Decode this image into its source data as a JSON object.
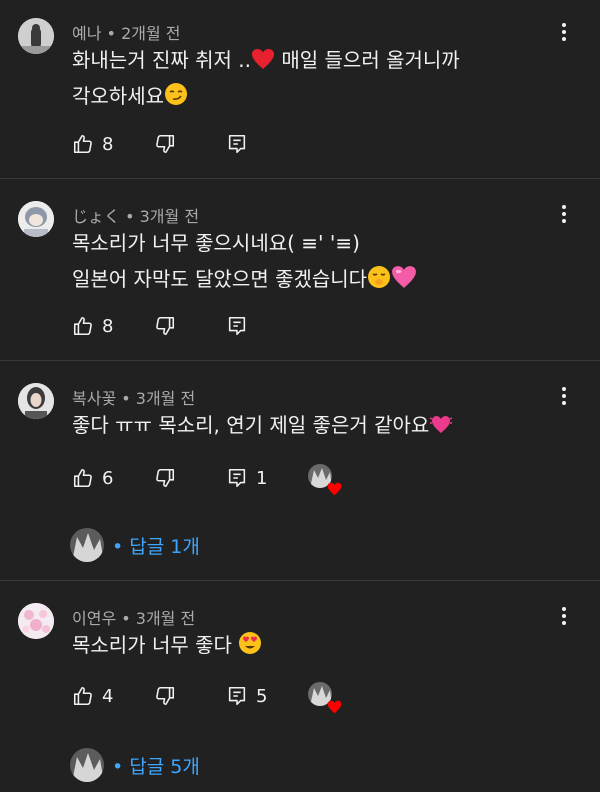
{
  "comments": [
    {
      "author": "예나",
      "time": "2개월 전",
      "lines": [
        "화내는거 진짜 취저 ..",
        " 매일 들으러 올거니까",
        "각오하세요"
      ],
      "likes": "8"
    },
    {
      "author": "じょく",
      "time": "3개월 전",
      "lines": [
        "목소리가 너무 좋으시네요( ≡' '≡)",
        "일본어 자막도 달았으면 좋겠습니다"
      ],
      "likes": "8"
    },
    {
      "author": "복사꽃",
      "time": "3개월 전",
      "lines": [
        "좋다 ㅠㅠ 목소리, 연기 제일 좋은거 같아요"
      ],
      "likes": "6",
      "reply_count": "1",
      "replies_label": "• 답글 1개"
    },
    {
      "author": "이연우",
      "time": "3개월 전",
      "lines": [
        "목소리가 너무 좋다 "
      ],
      "likes": "4",
      "reply_count": "5",
      "replies_label": "• 답글 5개"
    }
  ],
  "separator": " • ",
  "colors": {
    "background": "#212121",
    "text": "#f1f1f1",
    "meta": "#aaaaaa",
    "link": "#3ea6ff",
    "divider": "#3a3a3a",
    "heart": "#ff0000"
  }
}
